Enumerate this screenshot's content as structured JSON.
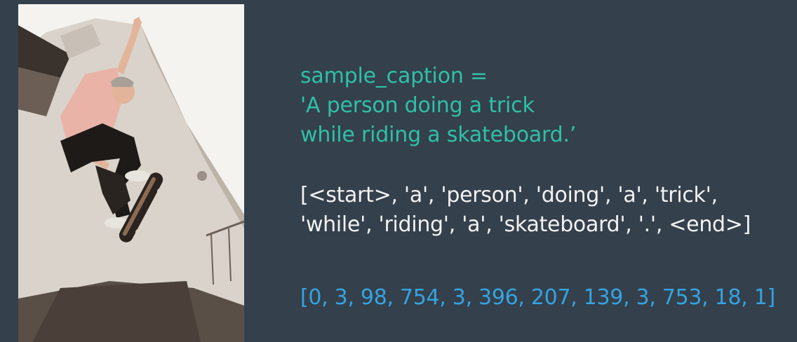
{
  "caption": {
    "assignment": "sample_caption =",
    "line1": "'A person doing a trick",
    "line2": "while riding a skateboard.’"
  },
  "tokens": {
    "line1": "[<start>, 'a', 'person', 'doing', 'a', 'trick',",
    "line2": "'while', 'riding', 'a', 'skateboard', '.', <end>]"
  },
  "indices": {
    "line": "[0, 3, 98, 754, 3, 396, 207, 139, 3, 753, 18, 1]"
  },
  "colors": {
    "background": "#34404c",
    "caption": "#2fc0a7",
    "tokens": "#f2f2f2",
    "indices": "#36a3e0"
  }
}
